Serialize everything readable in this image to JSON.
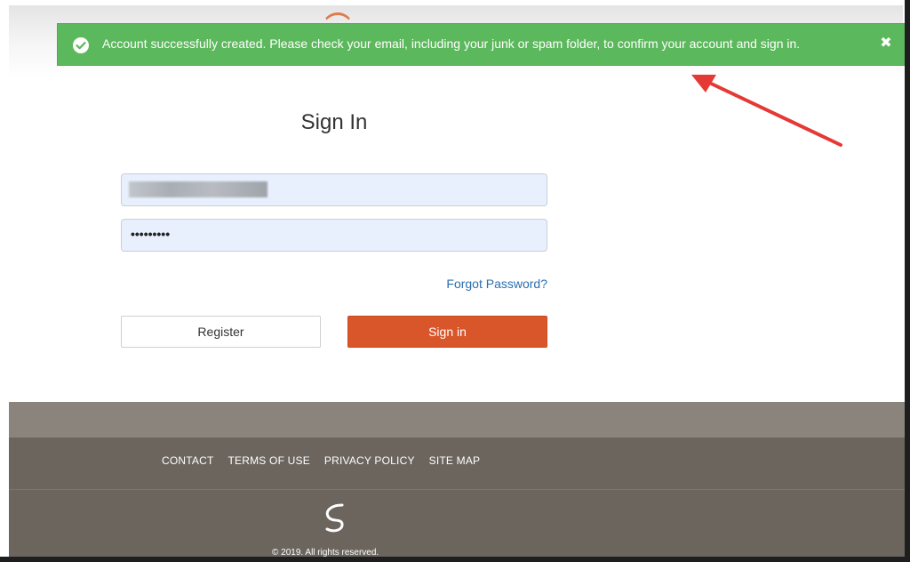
{
  "alert": {
    "message": "Account successfully created. Please check your email, including your junk or spam folder, to confirm your account and sign in.",
    "close_symbol": "✖",
    "icon": "check-circle-icon",
    "color": "#5cb85c"
  },
  "signin": {
    "title": "Sign In",
    "password_mask": "•••••••••",
    "forgot_label": "Forgot Password?",
    "register_label": "Register",
    "signin_label": "Sign in",
    "signin_color": "#d9562a"
  },
  "footer": {
    "links": [
      "CONTACT",
      "TERMS OF USE",
      "PRIVACY POLICY",
      "SITE MAP"
    ],
    "copyright": "© 2019. All rights reserved."
  }
}
